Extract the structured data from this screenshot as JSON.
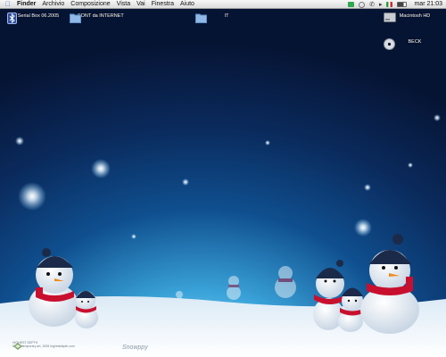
{
  "menubar": {
    "apple_icon": "apple-logo-icon",
    "menus": [
      "Finder",
      "Archivio",
      "Composizione",
      "Vista",
      "Vai",
      "Finestra",
      "Aiuto"
    ],
    "status_icons": [
      "green-menu-icon",
      "clock-status-icon",
      "phone-icon",
      "volume-icon",
      "flag-icon",
      "battery-icon"
    ],
    "clock": "mar 21:03"
  },
  "desktop_icons": [
    {
      "label": "Serial Box 06.2005",
      "icon": "bluetooth-file-icon"
    },
    {
      "label": "FONT da INTERNET",
      "icon": "folder-icon"
    },
    {
      "label": "IT",
      "icon": "folder-icon"
    },
    {
      "label": "Macintosh HD",
      "icon": "hard-drive-icon"
    },
    {
      "label": "BECK",
      "icon": "cd-icon"
    }
  ],
  "wallpaper": {
    "signature": "Snowppy",
    "credit_lines": [
      "HIGHEST DEPTH",
      "Di Contemporary art, 2005 highestdepth.com"
    ],
    "colors": {
      "sky_top": "#061434",
      "sky_horizon": "#3aa3d9",
      "snow": "#f2f6fa",
      "scarf": "#c8102e",
      "hat": "#1c2a4a"
    }
  }
}
